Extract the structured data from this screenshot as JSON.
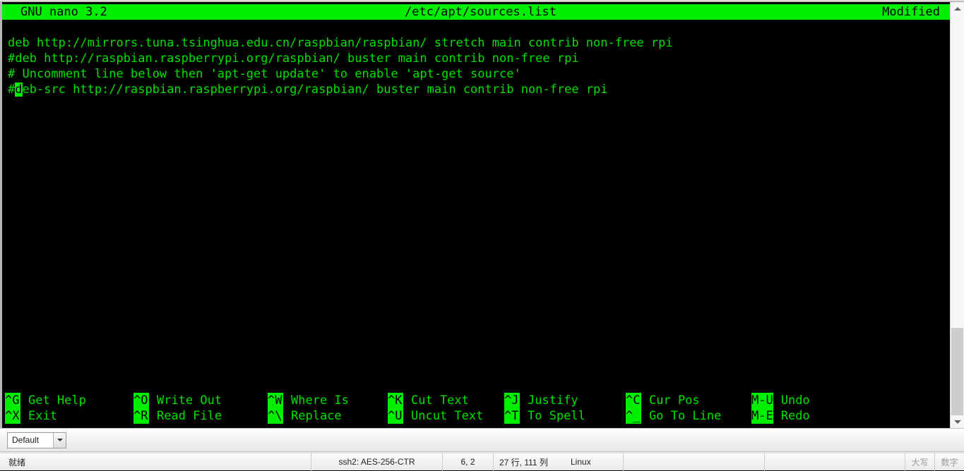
{
  "terminal": {
    "title_left": "GNU nano 3.2",
    "title_center": "/etc/apt/sources.list",
    "title_right": "Modified",
    "lines": [
      "deb http://mirrors.tuna.tsinghua.edu.cn/raspbian/raspbian/ stretch main contrib non-free rpi",
      "#deb http://raspbian.raspberrypi.org/raspbian/ buster main contrib non-free rpi",
      "# Uncomment line below then 'apt-get update' to enable 'apt-get source'",
      "#deb-src http://raspbian.raspberrypi.org/raspbian/ buster main contrib non-free rpi"
    ],
    "cursor": {
      "line_index": 3,
      "col_index": 1,
      "char": "d"
    },
    "colors": {
      "background": "#000000",
      "foreground": "#00e000",
      "highlight_bg": "#00ee00",
      "highlight_fg": "#000000"
    }
  },
  "help": [
    {
      "key": "^G",
      "label": "Get Help"
    },
    {
      "key": "^O",
      "label": "Write Out"
    },
    {
      "key": "^W",
      "label": "Where Is"
    },
    {
      "key": "^K",
      "label": "Cut Text"
    },
    {
      "key": "^J",
      "label": "Justify"
    },
    {
      "key": "^C",
      "label": "Cur Pos"
    },
    {
      "key": "M-U",
      "label": "Undo"
    },
    {
      "key": "^X",
      "label": "Exit"
    },
    {
      "key": "^R",
      "label": "Read File"
    },
    {
      "key": "^\\",
      "label": "Replace"
    },
    {
      "key": "^U",
      "label": "Uncut Text"
    },
    {
      "key": "^T",
      "label": "To Spell"
    },
    {
      "key": "^_",
      "label": "Go To Line"
    },
    {
      "key": "M-E",
      "label": "Redo"
    }
  ],
  "toolbar": {
    "session_combo_value": "Default"
  },
  "statusbar": {
    "ready": "就绪",
    "encryption": "ssh2: AES-256-CTR",
    "position": "6,  2",
    "lines_cols": "27 行, 111 列",
    "os": "Linux",
    "caps": "大写",
    "num": "数字"
  },
  "scrollbar": {
    "up_arrow": "chevron-up",
    "down_arrow": "chevron-down"
  }
}
